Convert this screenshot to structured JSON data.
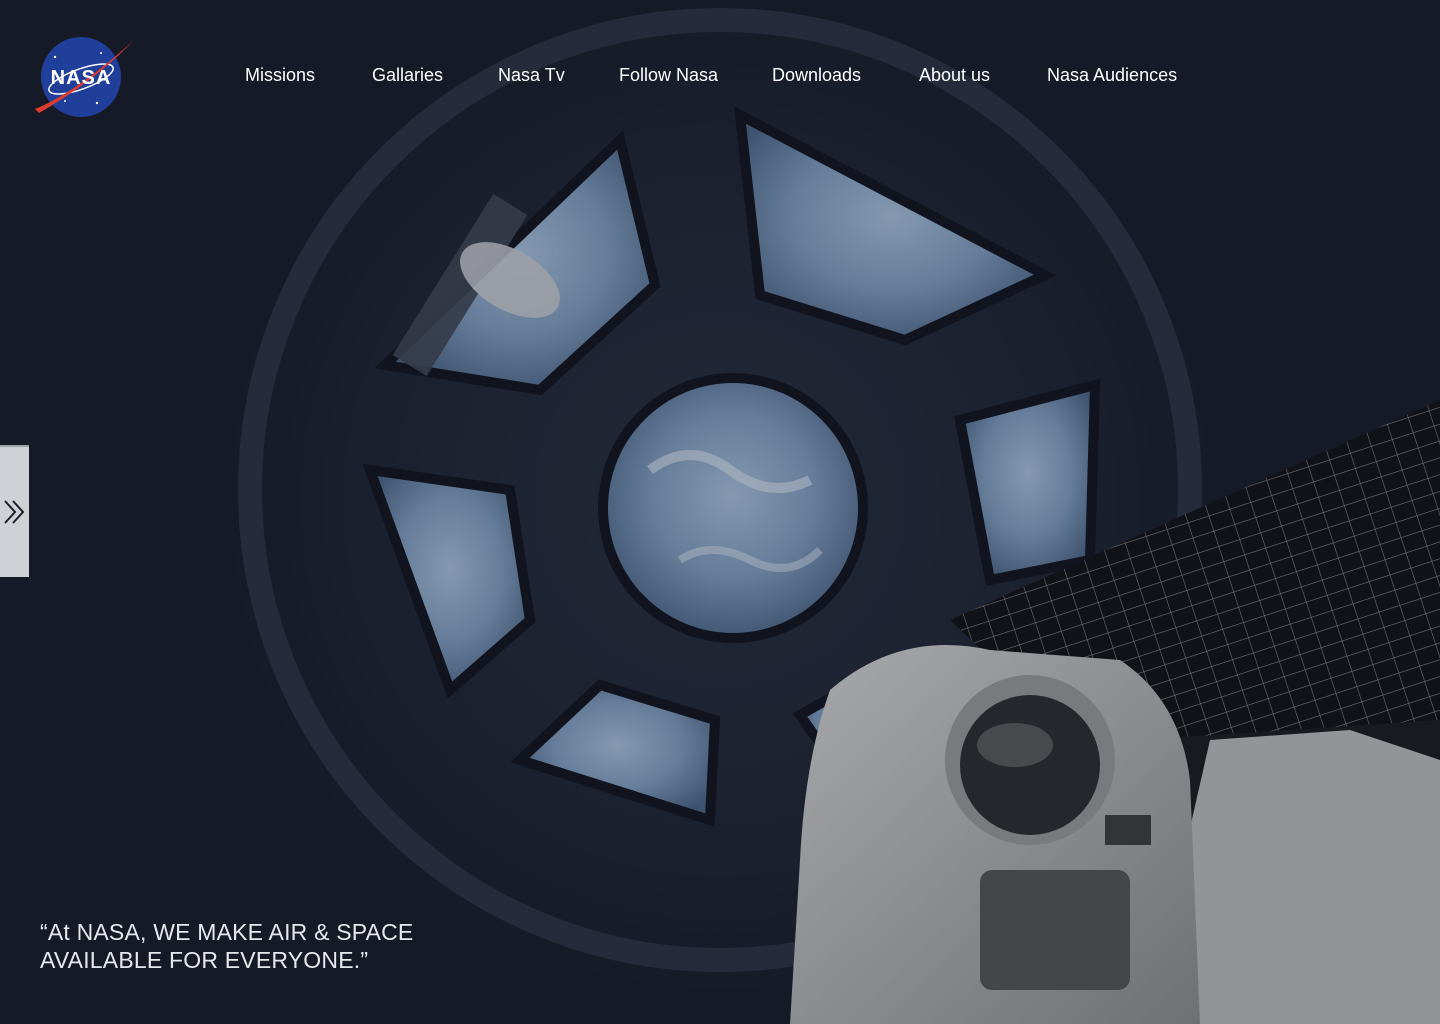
{
  "brand": {
    "logo_text": "NASA",
    "logo_blue": "#1f3f9b",
    "logo_red": "#e03a2f"
  },
  "nav": {
    "items": [
      {
        "label": "Missions"
      },
      {
        "label": "Gallaries"
      },
      {
        "label": "Nasa Tv"
      },
      {
        "label": "Follow Nasa"
      },
      {
        "label": "Downloads"
      },
      {
        "label": "About us"
      },
      {
        "label": "Nasa Audiences"
      }
    ]
  },
  "sidebar_toggle": {
    "icon": "double-chevron-right-icon"
  },
  "hero": {
    "quote": "“At NASA, WE MAKE  AIR & SPACE\n AVAILABLE FOR EVERYONE.”",
    "background_color": "#161a27"
  }
}
